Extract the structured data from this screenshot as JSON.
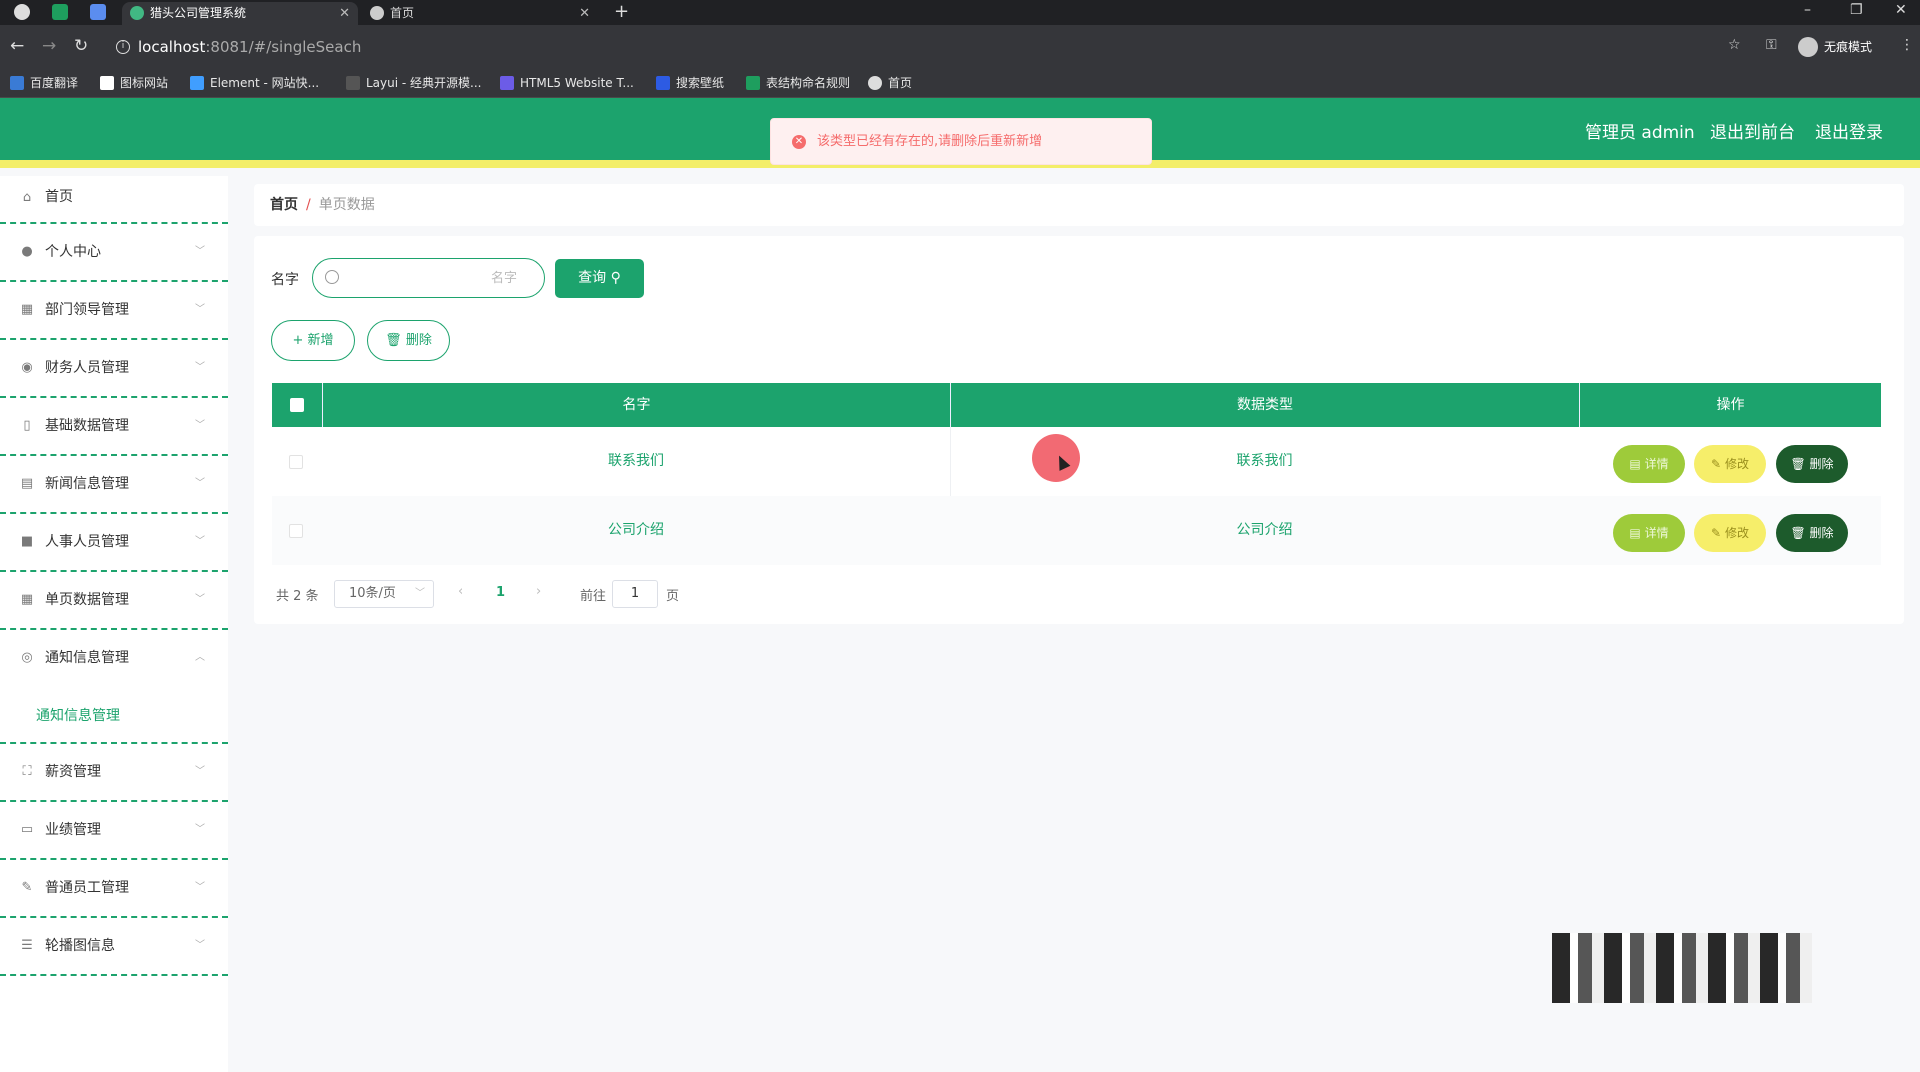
{
  "browser": {
    "tabs": [
      {
        "label": "猎头公司管理系统",
        "active": true
      },
      {
        "label": "首页",
        "active": false
      }
    ],
    "url_host": "localhost",
    "url_rest": ":8081/#/singleSeach",
    "profile_label": "无痕模式",
    "bookmarks": [
      "百度翻译",
      "图标网站",
      "Element - 网站快...",
      "Layui - 经典开源模...",
      "HTML5 Website T...",
      "搜索壁纸",
      "表结构命名规则",
      "首页"
    ]
  },
  "header": {
    "toast_message": "该类型已经有存在的,请删除后重新新增",
    "admin_label": "管理员 admin",
    "back_front_label": "退出到前台",
    "logout_label": "退出登录",
    "color": "#1ca36d",
    "accent": "#f3ee69"
  },
  "sidebar": {
    "items": [
      {
        "label": "首页",
        "icon": "home-icon"
      },
      {
        "label": "个人中心",
        "icon": "user-icon"
      },
      {
        "label": "部门领导管理",
        "icon": "grid-icon"
      },
      {
        "label": "财务人员管理",
        "icon": "pin-icon"
      },
      {
        "label": "基础数据管理",
        "icon": "lock-icon"
      },
      {
        "label": "新闻信息管理",
        "icon": "news-icon"
      },
      {
        "label": "人事人员管理",
        "icon": "monitor-icon"
      },
      {
        "label": "单页数据管理",
        "icon": "table-icon"
      },
      {
        "label": "通知信息管理",
        "icon": "compass-icon"
      },
      {
        "label": "薪资管理",
        "icon": "expand-icon"
      },
      {
        "label": "业绩管理",
        "icon": "chat-icon"
      },
      {
        "label": "普通员工管理",
        "icon": "edit-icon"
      },
      {
        "label": "轮播图信息",
        "icon": "menu-icon"
      }
    ],
    "submenu_label": "通知信息管理"
  },
  "breadcrumb": {
    "home": "首页",
    "separator": "/",
    "current": "单页数据"
  },
  "search": {
    "label": "名字",
    "placeholder": "名字",
    "query_button": "查询"
  },
  "actions": {
    "add": "新增",
    "delete": "删除"
  },
  "table": {
    "headers": [
      "名字",
      "数据类型",
      "操作"
    ],
    "rows": [
      {
        "name": "联系我们",
        "type": "联系我们"
      },
      {
        "name": "公司介绍",
        "type": "公司介绍"
      }
    ],
    "row_actions": {
      "detail": "详情",
      "edit": "修改",
      "delete": "删除"
    }
  },
  "pagination": {
    "total": "共 2 条",
    "page_size": "10条/页",
    "current_page": "1",
    "goto_label": "前往",
    "goto_value": "1",
    "page_word": "页"
  }
}
